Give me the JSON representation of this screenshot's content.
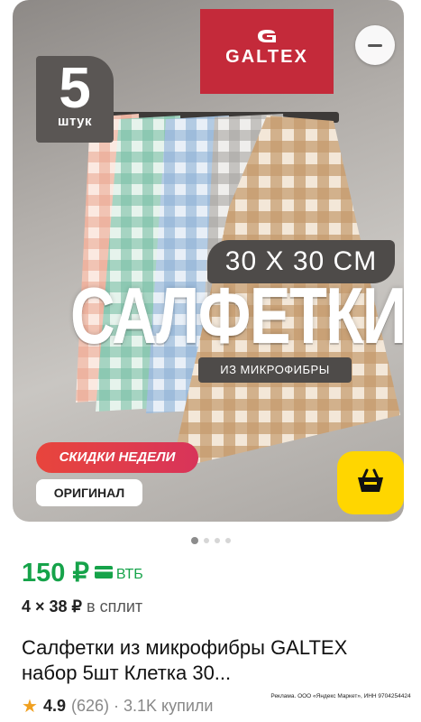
{
  "product_image": {
    "pack_count": "5",
    "pack_unit": "штук",
    "brand": "GALTEX",
    "size": "30 X 30 CM",
    "product_word": "САЛФЕТКИ",
    "material": "ИЗ МИКРОФИБРЫ",
    "promo_badge": "СКИДКИ НЕДЕЛИ",
    "original_badge": "ОРИГИНАЛ",
    "towel_colors": [
      "#e9a68f",
      "#7cc0a6",
      "#8fb3d6",
      "#a9a6a3",
      "#c59a6c"
    ],
    "accent_yellow": "#ffd600"
  },
  "carousel": {
    "total": 4,
    "active": 0
  },
  "pricing": {
    "price": "150 ₽",
    "bank_label": "ВТБ",
    "split_amount": "4 × 38 ₽",
    "split_label": "в сплит",
    "price_color": "#16a34a"
  },
  "product": {
    "title": "Салфетки из микрофибры GALTEX набор 5шт Клетка 30..."
  },
  "rating": {
    "score": "4.9",
    "reviews": "(626)",
    "separator": "·",
    "bought": "3.1K купили"
  },
  "ad": {
    "disclaimer": "Реклама. ООО «Яндекс Маркет», ИНН 9704254424"
  }
}
